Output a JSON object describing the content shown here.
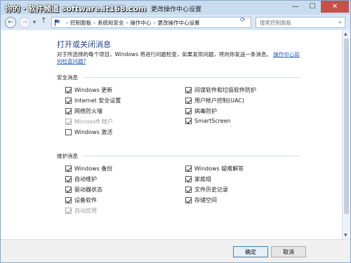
{
  "watermark": "你的・软件频道 software.it168.com",
  "window": {
    "title": "更改操作中心设置",
    "minimize": "—",
    "maximize": "☐",
    "close": "✕"
  },
  "address": {
    "breadcrumbs": [
      "控制面板",
      "系统和安全",
      "操作中心",
      "更改操作中心设置"
    ],
    "separator": "›",
    "search_placeholder": "搜索控制面板"
  },
  "main": {
    "heading": "打开或关闭消息",
    "description": "对于所选择的每个项目，Windows 将进行问题检查，如果发现问题，将向你发送一条消息。",
    "description_link": "操作中心如何检查问题?",
    "security": {
      "title": "安全消息",
      "items": [
        {
          "label": "Windows 更新",
          "checked": true,
          "disabled": false
        },
        {
          "label": "Internet 安全设置",
          "checked": true,
          "disabled": false
        },
        {
          "label": "网络防火墙",
          "checked": true,
          "disabled": false
        },
        {
          "label": "Microsoft 帐户",
          "checked": true,
          "disabled": true
        },
        {
          "label": "Windows 激活",
          "checked": false,
          "disabled": false
        },
        {
          "label": "间谍软件和垃圾软件防护",
          "checked": true,
          "disabled": false
        },
        {
          "label": "用户帐户控制(UAC)",
          "checked": true,
          "disabled": false
        },
        {
          "label": "病毒防护",
          "checked": true,
          "disabled": false
        },
        {
          "label": "SmartScreen",
          "checked": true,
          "disabled": false
        }
      ]
    },
    "maintenance": {
      "title": "维护消息",
      "items": [
        {
          "label": "Windows 备份",
          "checked": true,
          "disabled": false
        },
        {
          "label": "自动维护",
          "checked": true,
          "disabled": false
        },
        {
          "label": "驱动器状态",
          "checked": true,
          "disabled": false
        },
        {
          "label": "设备软件",
          "checked": true,
          "disabled": false
        },
        {
          "label": "自动应用",
          "checked": true,
          "disabled": true
        },
        {
          "label": "Windows 疑难解答",
          "checked": true,
          "disabled": false
        },
        {
          "label": "家庭组",
          "checked": true,
          "disabled": false
        },
        {
          "label": "文件历史记录",
          "checked": true,
          "disabled": false
        },
        {
          "label": "存储空间",
          "checked": true,
          "disabled": false
        }
      ]
    }
  },
  "footer": {
    "ok_label": "确定",
    "cancel_label": "取消"
  },
  "icons": {
    "back": "back-arrow-icon",
    "forward": "forward-arrow-icon",
    "up": "up-arrow-icon",
    "flag": "action-center-flag-icon",
    "refresh": "refresh-icon",
    "search": "search-icon"
  },
  "colors": {
    "heading": "#1f3f8a",
    "link": "#2459b8",
    "close_button": "#c7504a"
  }
}
